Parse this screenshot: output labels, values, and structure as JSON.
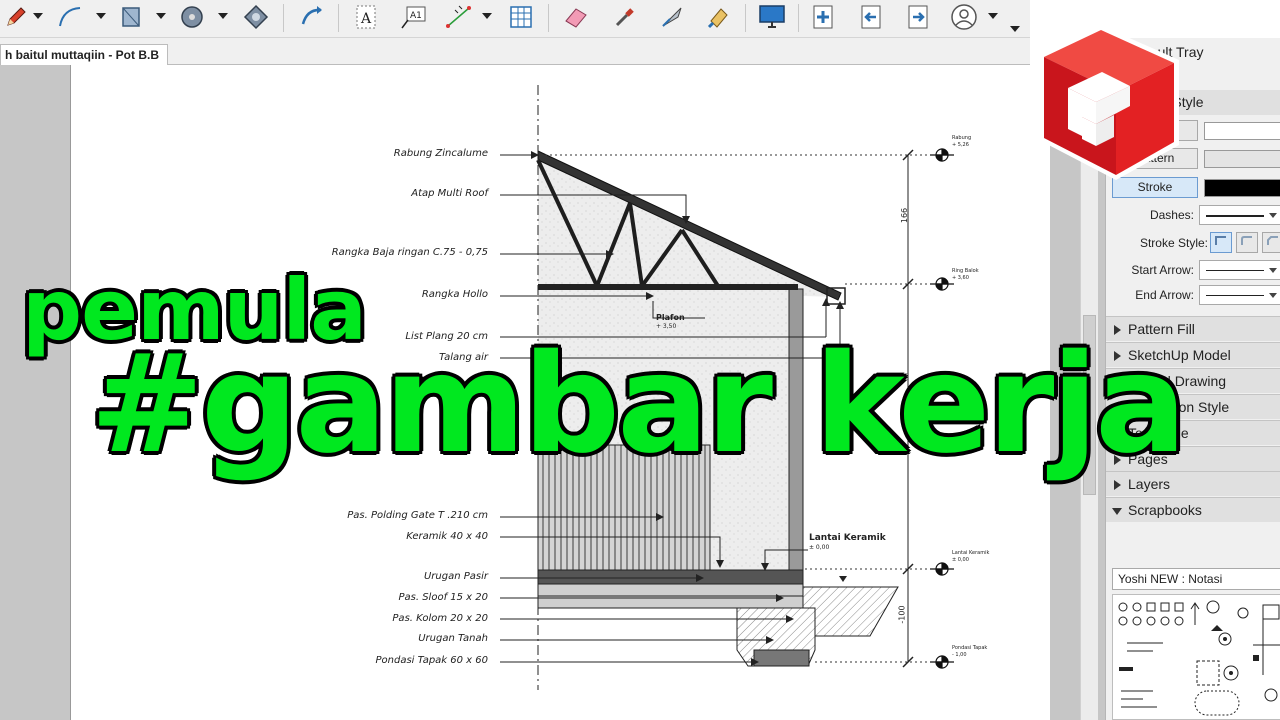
{
  "app": {
    "document_tab": "h baitul muttaqiin - Pot B.B",
    "accent_color": "#00e81f",
    "logo_color": "#e32123"
  },
  "toolbar": {
    "tools": [
      "pencil-icon",
      "arc-icon",
      "rectangle-icon",
      "circle-icon",
      "offset-icon",
      "flip-icon",
      "text-icon",
      "label-icon",
      "dimension-icon",
      "table-icon",
      "eraser-icon",
      "eyedropper-icon",
      "split-icon",
      "paint-icon",
      "monitor-icon",
      "add-page-icon",
      "previous-page-icon",
      "next-page-icon",
      "user-icon"
    ]
  },
  "drawing": {
    "labels": {
      "rabung": "Rabung Zincalume",
      "atap": "Atap Multi Roof",
      "rangka_baja": "Rangka Baja ringan C.75 - 0,75",
      "rangka_hollo": "Rangka Hollo",
      "list_plang": "List Plang 20 cm",
      "talang": "Talang air",
      "polding": "Pas. Polding Gate T .210 cm",
      "keramik": "Keramik 40 x 40",
      "urugan_pasir": "Urugan Pasir",
      "sloof": "Pas. Sloof 15 x 20",
      "kolom": "Pas. Kolom 20 x 20",
      "urugan_tanah": "Urugan Tanah",
      "pondasi": "Pondasi Tapak 60 x 60",
      "plafon": "Plafon",
      "plafon_level": "+ 3,50",
      "lantai": "Lantai Keramik",
      "lantai_level": "± 0,00",
      "dim_top": "166",
      "dim_bottom": "-100",
      "rabung_elev_label": "Rabung",
      "rabung_elev": "+ 5,26",
      "ring_elev_label": "Ring Balok",
      "ring_elev": "+ 3,60",
      "lantai_elev_label": "Lantai Keramik",
      "lantai_elev": "± 0,00",
      "pondasi_elev_label": "Pondasi Tapak",
      "pondasi_elev": "- 1,00"
    }
  },
  "overlay": {
    "line1": "pemula",
    "line2": "#gambar kerja"
  },
  "panel": {
    "tray_title": "Default Tray",
    "shape_style": "Shape Style",
    "pattern_label": "Pattern",
    "stroke_label": "Stroke",
    "dashes_label": "Dashes:",
    "stroke_style_label": "Stroke Style:",
    "start_arrow_label": "Start Arrow:",
    "end_arrow_label": "End Arrow:",
    "sections": [
      "Pattern Fill",
      "SketchUp Model",
      "Scaled Drawing",
      "Dimension Style",
      "Text Style",
      "Pages",
      "Layers",
      "Scrapbooks"
    ],
    "scrapbook_selected": "Yoshi NEW : Notasi"
  }
}
